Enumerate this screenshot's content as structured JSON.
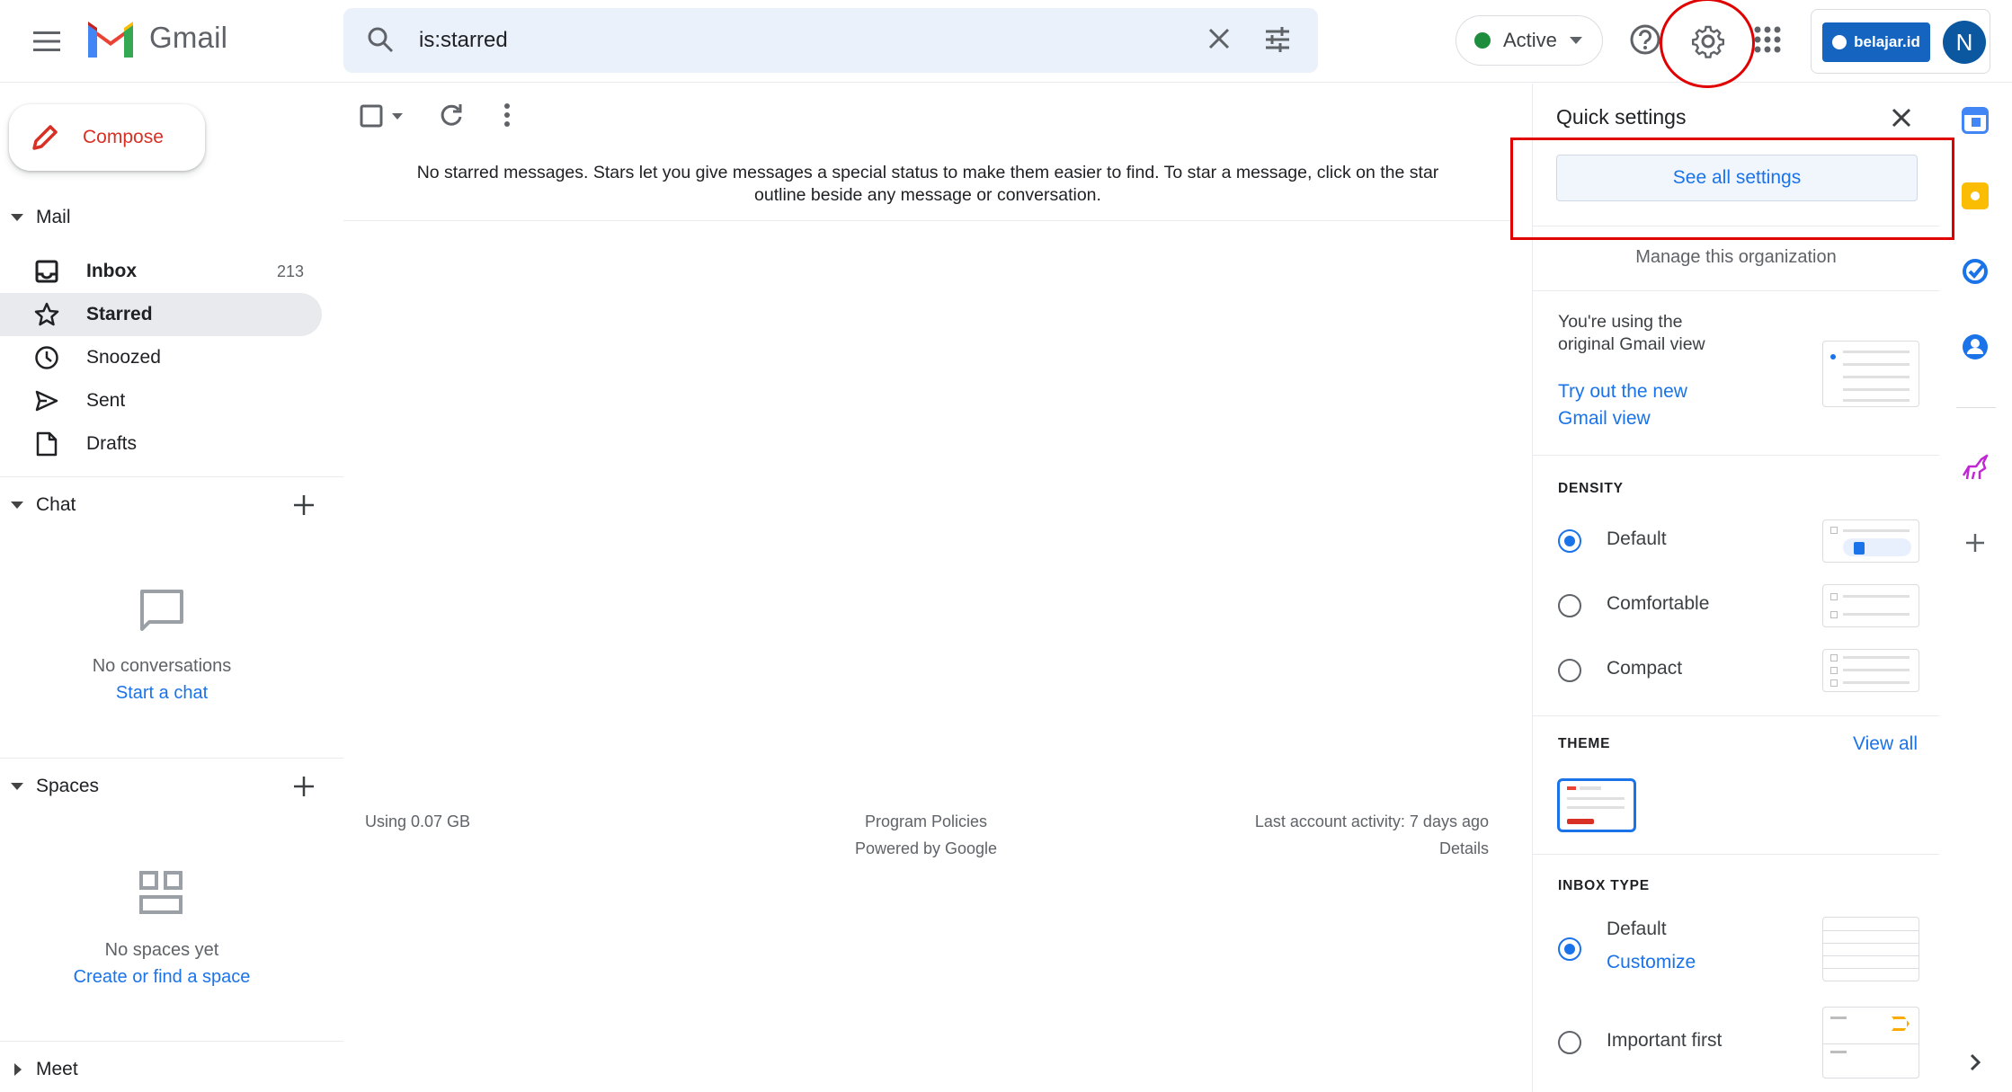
{
  "header": {
    "app_name": "Gmail",
    "search_query": "is:starred",
    "status_label": "Active",
    "org_badge": "belajar.id",
    "avatar_initial": "N"
  },
  "sidebar": {
    "compose_label": "Compose",
    "mail_section": "Mail",
    "items": [
      {
        "label": "Inbox",
        "count": "213"
      },
      {
        "label": "Starred"
      },
      {
        "label": "Snoozed"
      },
      {
        "label": "Sent"
      },
      {
        "label": "Drafts"
      }
    ],
    "chat_section": "Chat",
    "chat_empty": "No conversations",
    "chat_link": "Start a chat",
    "spaces_section": "Spaces",
    "spaces_empty": "No spaces yet",
    "spaces_link": "Create or find a space",
    "meet_section": "Meet"
  },
  "main": {
    "empty_message_line1": "No starred messages. Stars let you give messages a special status to make them easier to find. To star a message, click on the star",
    "empty_message_line2": "outline beside any message or conversation.",
    "storage": "Using 0.07 GB",
    "program_policies": "Program Policies",
    "powered_by": "Powered by Google",
    "last_activity": "Last account activity: 7 days ago",
    "details": "Details"
  },
  "quick_settings": {
    "title": "Quick settings",
    "see_all": "See all settings",
    "manage_org": "Manage this organization",
    "view_line1": "You're using the",
    "view_line2": "original Gmail view",
    "try_line1": "Try out the new",
    "try_line2": "Gmail view",
    "density_heading": "DENSITY",
    "density_options": [
      "Default",
      "Comfortable",
      "Compact"
    ],
    "theme_heading": "THEME",
    "theme_view_all": "View all",
    "inbox_heading": "INBOX TYPE",
    "inbox_default": "Default",
    "inbox_customize": "Customize",
    "inbox_important": "Important first"
  },
  "colors": {
    "gmail_red": "#ea4335",
    "link_blue": "#1a73e8",
    "active_green": "#1e8e3e",
    "annotation_red": "#e00000"
  }
}
